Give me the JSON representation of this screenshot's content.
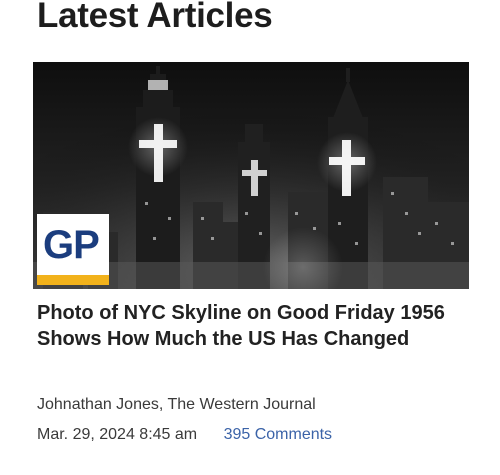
{
  "section": {
    "title": "Latest Articles"
  },
  "article": {
    "headline": "Photo of NYC Skyline on Good Friday 1956 Shows How Much the US Has Changed",
    "author": "Johnathan Jones, The Western Journal",
    "date": "Mar. 29, 2024 8:45 am",
    "comments": "395 Comments",
    "image_alt": "Black and white photo of New York City skyline at night with illuminated crosses on skyscrapers",
    "publisher_logo": {
      "text": "GP",
      "text_color": "#1b3d7e",
      "bar_color": "#f2b21b"
    }
  },
  "colors": {
    "title": "#1d1d1d",
    "link": "#3b63a8",
    "meta": "#3a3a3a"
  }
}
